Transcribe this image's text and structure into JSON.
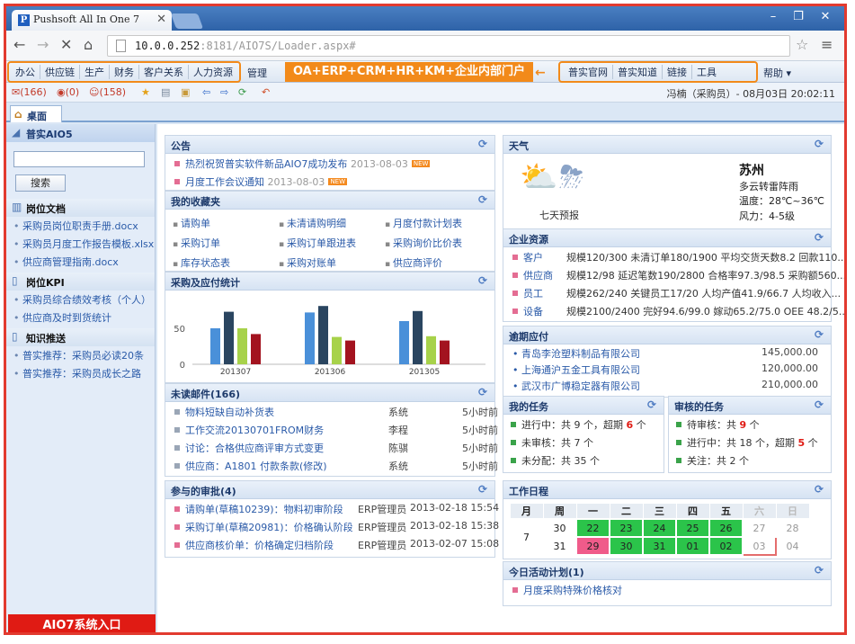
{
  "browser": {
    "tab_title": "Pushsoft All In One 7",
    "url_host": "10.0.0.252",
    "url_rest": ":8181/AIO7S/Loader.aspx#"
  },
  "menu": {
    "left_items": [
      "办公",
      "供应链",
      "生产",
      "财务",
      "客户关系",
      "人力资源"
    ],
    "manage": "管理",
    "banner": "OA+ERP+CRM+HR+KM+企业内部门户",
    "right_items": [
      "普实官网",
      "普实知道",
      "链接",
      "工具"
    ],
    "help": "帮助"
  },
  "toolbar": {
    "mail_count": "(166)",
    "msg_count": "(0)",
    "people_count": "(158)",
    "user_info": "冯楠（采购员）- 08月03日 20:02:11"
  },
  "desktop_tab": "桌面",
  "sidebar": {
    "title": "普实AIO5",
    "search_button": "搜索",
    "docs_title": "岗位文档",
    "docs": [
      "采购员岗位职责手册.docx",
      "采购员月度工作报告模板.xlsx",
      "供应商管理指南.docx"
    ],
    "kpi_title": "岗位KPI",
    "kpi": [
      "采购员综合绩效考核（个人）",
      "供应商及时到货统计"
    ],
    "push_title": "知识推送",
    "push": [
      "普实推荐：采购员必读20条",
      "普实推荐：采购员成长之路"
    ],
    "entry": "AIO7系统入口"
  },
  "notice": {
    "title": "公告",
    "items": [
      {
        "text": "热烈祝贺普实软件新品AIO7成功发布",
        "date": "2013-08-03"
      },
      {
        "text": "月度工作会议通知",
        "date": "2013-08-03"
      }
    ],
    "new_label": "NEW"
  },
  "favorites": {
    "title": "我的收藏夹",
    "items": [
      "请购单",
      "未清请购明细",
      "月度付款计划表",
      "采购订单",
      "采购订单跟进表",
      "采购询价比价表",
      "库存状态表",
      "采购对账单",
      "供应商评价"
    ]
  },
  "purchase_chart": {
    "title": "采购及应付统计"
  },
  "chart_data": {
    "type": "bar",
    "categories": [
      "201307",
      "201306",
      "201305"
    ],
    "series": [
      {
        "values": [
          50,
          72,
          60
        ]
      },
      {
        "values": [
          73,
          81,
          74
        ]
      },
      {
        "values": [
          50,
          38,
          39
        ]
      },
      {
        "values": [
          42,
          33,
          33
        ]
      }
    ],
    "ylim": [
      0,
      100
    ],
    "ticks": [
      0,
      50
    ],
    "colors": [
      "#4a90d9",
      "#2a4560",
      "#a7d24a",
      "#a3131f"
    ]
  },
  "mail": {
    "title": "未读邮件(166)",
    "items": [
      {
        "text": "物料短缺自动补货表",
        "from": "系统",
        "time": "5小时前"
      },
      {
        "text": "工作交流20130701FROM财务",
        "from": "李程",
        "time": "5小时前"
      },
      {
        "text": "讨论：合格供应商评审方式变更",
        "from": "陈骐",
        "time": "5小时前"
      },
      {
        "text": "供应商：A1801 付款条款(修改)",
        "from": "系统",
        "time": "5小时前"
      }
    ]
  },
  "approvals": {
    "title": "参与的审批(4)",
    "items": [
      {
        "text": "请购单(草稿10239)：物料初审阶段",
        "who": "ERP管理员",
        "time": "2013-02-18 15:54"
      },
      {
        "text": "采购订单(草稿20981)：价格确认阶段",
        "who": "ERP管理员",
        "time": "2013-02-18 15:38"
      },
      {
        "text": "供应商核价单：价格确定归档阶段",
        "who": "ERP管理员",
        "time": "2013-02-07 15:08"
      }
    ]
  },
  "weather": {
    "title": "天气",
    "forecast": "七天预报",
    "city": "苏州",
    "desc": "多云转雷阵雨",
    "temp": "温度：28℃~36℃",
    "wind": "风力：4-5级"
  },
  "enterprise": {
    "title": "企业资源",
    "items": [
      {
        "label": "客户",
        "text": "规模120/300 未清订单180/1900 平均交货天数8.2 回款110..."
      },
      {
        "label": "供应商",
        "text": "规模12/98 延迟笔数190/2800 合格率97.3/98.5 采购额560..."
      },
      {
        "label": "员工",
        "text": "规模262/240 关键员工17/20 人均产值41.9/66.7 人均收入..."
      },
      {
        "label": "设备",
        "text": "规模2100/2400 完好94.6/99.0 嫁动65.2/75.0 OEE 48.2/5..."
      }
    ]
  },
  "overdue": {
    "title": "逾期应付",
    "items": [
      {
        "name": "青岛李沧塑料制品有限公司",
        "amount": "145,000.00"
      },
      {
        "name": "上海通沪五金工具有限公司",
        "amount": "120,000.00"
      },
      {
        "name": "武汉市广博稳定器有限公司",
        "amount": "210,000.00"
      }
    ]
  },
  "my_tasks": {
    "title": "我的任务",
    "l1a": "进行中：共 9 个，超期 ",
    "l1b": "6",
    "l1c": " 个",
    "l2": "未审核：共 7 个",
    "l3": "未分配：共 35 个"
  },
  "review_tasks": {
    "title": "审核的任务",
    "l1a": "待审核：共 ",
    "l1b": "9",
    "l1c": " 个",
    "l2a": "进行中：共 18 个，超期 ",
    "l2b": "5",
    "l2c": " 个",
    "l3": "关注：共 2 个"
  },
  "calendar": {
    "title": "工作日程",
    "headers": [
      "月",
      "周",
      "一",
      "二",
      "三",
      "四",
      "五",
      "六",
      "日"
    ],
    "month": "7",
    "week1": "30",
    "week2": "31",
    "days1": [
      "22",
      "23",
      "24",
      "25",
      "26",
      "27",
      "28"
    ],
    "days2": [
      "29",
      "30",
      "31",
      "01",
      "02",
      "03",
      "04"
    ]
  },
  "today_plan": {
    "title": "今日活动计划(1)",
    "item": "月度采购特殊价格核对"
  }
}
